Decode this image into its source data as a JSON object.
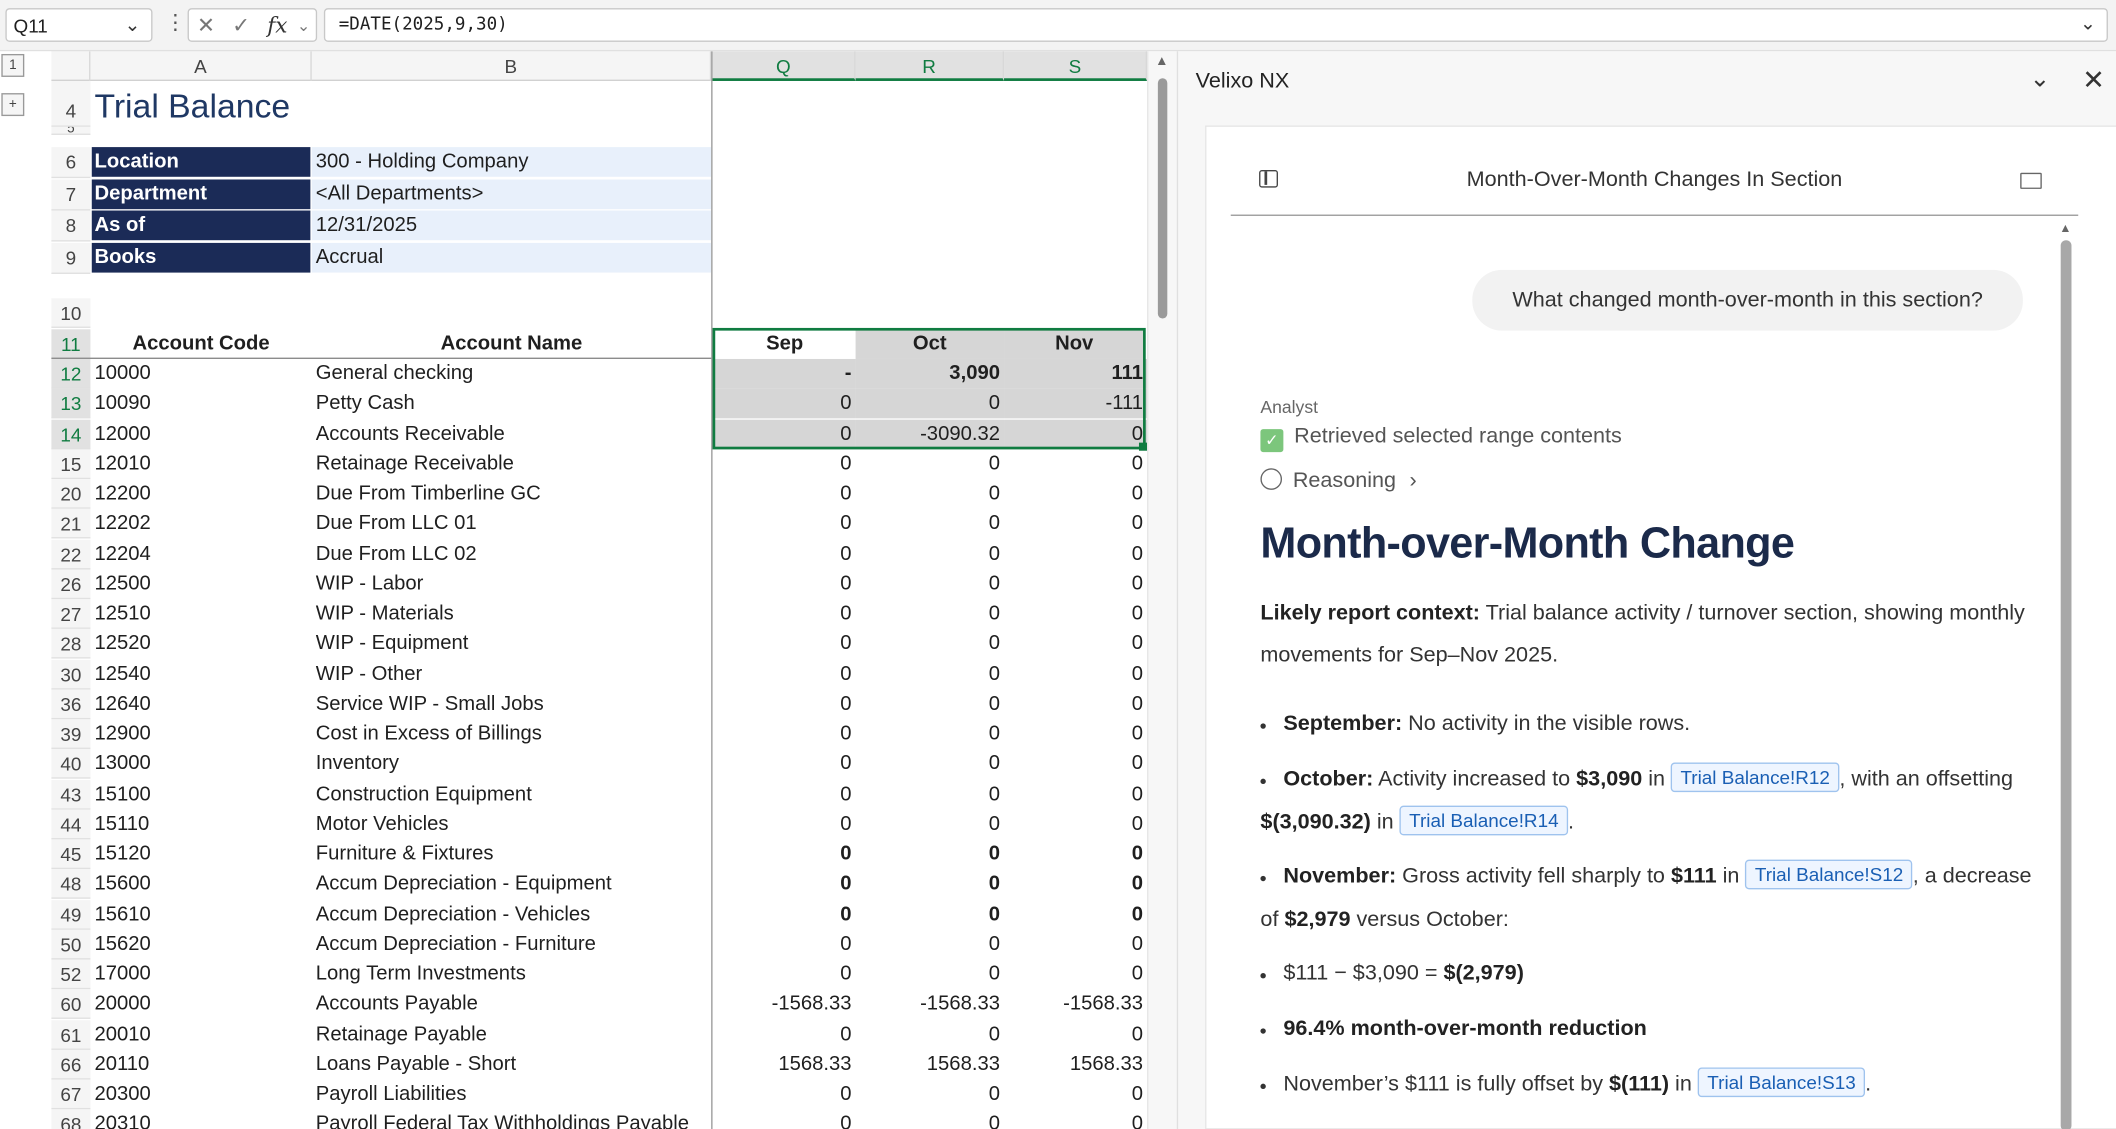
{
  "formula_bar": {
    "name_box": "Q11",
    "formula": "=DATE(2025,9,30)",
    "fx_label": "fx"
  },
  "outline": {
    "level1": "1",
    "expand": "+"
  },
  "columns": [
    "A",
    "B",
    "Q",
    "R",
    "S"
  ],
  "report": {
    "title": "Trial Balance",
    "params": [
      {
        "row": "6",
        "label": "Location",
        "value": "300 - Holding Company"
      },
      {
        "row": "7",
        "label": "Department",
        "value": "<All Departments>"
      },
      {
        "row": "8",
        "label": "As of",
        "value": "12/31/2025"
      },
      {
        "row": "9",
        "label": "Books",
        "value": "Accrual"
      }
    ],
    "headers": {
      "code": "Account Code",
      "name": "Account Name",
      "sep": "Sep",
      "oct": "Oct",
      "nov": "Nov"
    }
  },
  "row_numbers": {
    "r4": "4",
    "r5": "5",
    "r10": "10",
    "r11": "11"
  },
  "rows": [
    {
      "row": "12",
      "code": "10000",
      "name": "General checking",
      "sep": "-",
      "oct": "3,090",
      "nov": "111"
    },
    {
      "row": "13",
      "code": "10090",
      "name": "Petty Cash",
      "sep": "0",
      "oct": "0",
      "nov": "-111"
    },
    {
      "row": "14",
      "code": "12000",
      "name": "Accounts Receivable",
      "sep": "0",
      "oct": "-3090.32",
      "nov": "0"
    },
    {
      "row": "15",
      "code": "12010",
      "name": "Retainage Receivable",
      "sep": "0",
      "oct": "0",
      "nov": "0"
    },
    {
      "row": "20",
      "code": "12200",
      "name": "Due From Timberline GC",
      "sep": "0",
      "oct": "0",
      "nov": "0"
    },
    {
      "row": "21",
      "code": "12202",
      "name": "Due From LLC 01",
      "sep": "0",
      "oct": "0",
      "nov": "0"
    },
    {
      "row": "22",
      "code": "12204",
      "name": "Due From LLC 02",
      "sep": "0",
      "oct": "0",
      "nov": "0"
    },
    {
      "row": "26",
      "code": "12500",
      "name": "WIP - Labor",
      "sep": "0",
      "oct": "0",
      "nov": "0"
    },
    {
      "row": "27",
      "code": "12510",
      "name": "WIP - Materials",
      "sep": "0",
      "oct": "0",
      "nov": "0"
    },
    {
      "row": "28",
      "code": "12520",
      "name": "WIP - Equipment",
      "sep": "0",
      "oct": "0",
      "nov": "0"
    },
    {
      "row": "30",
      "code": "12540",
      "name": "WIP - Other",
      "sep": "0",
      "oct": "0",
      "nov": "0"
    },
    {
      "row": "36",
      "code": "12640",
      "name": "Service WIP - Small Jobs",
      "sep": "0",
      "oct": "0",
      "nov": "0"
    },
    {
      "row": "39",
      "code": "12900",
      "name": "Cost in Excess of Billings",
      "sep": "0",
      "oct": "0",
      "nov": "0"
    },
    {
      "row": "40",
      "code": "13000",
      "name": "Inventory",
      "sep": "0",
      "oct": "0",
      "nov": "0"
    },
    {
      "row": "43",
      "code": "15100",
      "name": "Construction Equipment",
      "sep": "0",
      "oct": "0",
      "nov": "0"
    },
    {
      "row": "44",
      "code": "15110",
      "name": "Motor Vehicles",
      "sep": "0",
      "oct": "0",
      "nov": "0"
    },
    {
      "row": "45",
      "code": "15120",
      "name": "Furniture & Fixtures",
      "sep": "0",
      "oct": "0",
      "nov": "0"
    },
    {
      "row": "48",
      "code": "15600",
      "name": "Accum Depreciation - Equipment",
      "sep": "0",
      "oct": "0",
      "nov": "0"
    },
    {
      "row": "49",
      "code": "15610",
      "name": "Accum Depreciation - Vehicles",
      "sep": "0",
      "oct": "0",
      "nov": "0"
    },
    {
      "row": "50",
      "code": "15620",
      "name": "Accum Depreciation - Furniture",
      "sep": "0",
      "oct": "0",
      "nov": "0"
    },
    {
      "row": "52",
      "code": "17000",
      "name": "Long Term Investments",
      "sep": "0",
      "oct": "0",
      "nov": "0"
    },
    {
      "row": "60",
      "code": "20000",
      "name": "Accounts Payable",
      "sep": "-1568.33",
      "oct": "-1568.33",
      "nov": "-1568.33"
    },
    {
      "row": "61",
      "code": "20010",
      "name": "Retainage Payable",
      "sep": "0",
      "oct": "0",
      "nov": "0"
    },
    {
      "row": "66",
      "code": "20110",
      "name": "Loans Payable - Short",
      "sep": "1568.33",
      "oct": "1568.33",
      "nov": "1568.33"
    },
    {
      "row": "67",
      "code": "20300",
      "name": "Payroll Liabilities",
      "sep": "0",
      "oct": "0",
      "nov": "0"
    },
    {
      "row": "68",
      "code": "20310",
      "name": "Payroll Federal Tax Withholdings Payable",
      "sep": "0",
      "oct": "0",
      "nov": "0"
    }
  ],
  "panel": {
    "title": "Velixo NX",
    "card_title": "Month-Over-Month Changes In Section",
    "user_message": "What changed month-over-month in this section?",
    "analyst_label": "Analyst",
    "retrieved": "Retrieved selected range contents",
    "reasoning": "Reasoning",
    "heading": "Month-over-Month Change",
    "context_label": "Likely report context:",
    "context_text": " Trial balance activity / turnover section, showing monthly movements for Sep–Nov 2025.",
    "bullets": {
      "sep_label": "September:",
      "sep_text": " No activity in the visible rows.",
      "oct_label": "October:",
      "oct_t1": " Activity increased to ",
      "oct_v1": "$3,090",
      "oct_t2": " in ",
      "oct_ref1": "Trial Balance!R12",
      "oct_t3": ", with an offsetting ",
      "oct_v2": "$(3,090.32)",
      "oct_t4": " in ",
      "oct_ref2": "Trial Balance!R14",
      "oct_t5": ".",
      "nov_label": "November:",
      "nov_t1": " Gross activity fell sharply to ",
      "nov_v1": "$111",
      "nov_t2": " in ",
      "nov_ref": "Trial Balance!S12",
      "nov_t3": ", a decrease of ",
      "nov_v2": "$2,979",
      "nov_t4": " versus October:",
      "calc_t": "$111 − $3,090 = ",
      "calc_v": "$(2,979)",
      "reduction": "96.4% month-over-month reduction",
      "offset_t1": "November’s $111 is fully offset by ",
      "offset_v": "$(111)",
      "offset_t2": " in ",
      "offset_ref": "Trial Balance!S13",
      "offset_t3": "."
    }
  },
  "colors": {
    "param_label_bg": "#1b2b57",
    "param_value_bg": "#e8f0fb",
    "title": "#1f3864",
    "selection": "#107c41",
    "selected_fill": "#d6d6d6"
  }
}
